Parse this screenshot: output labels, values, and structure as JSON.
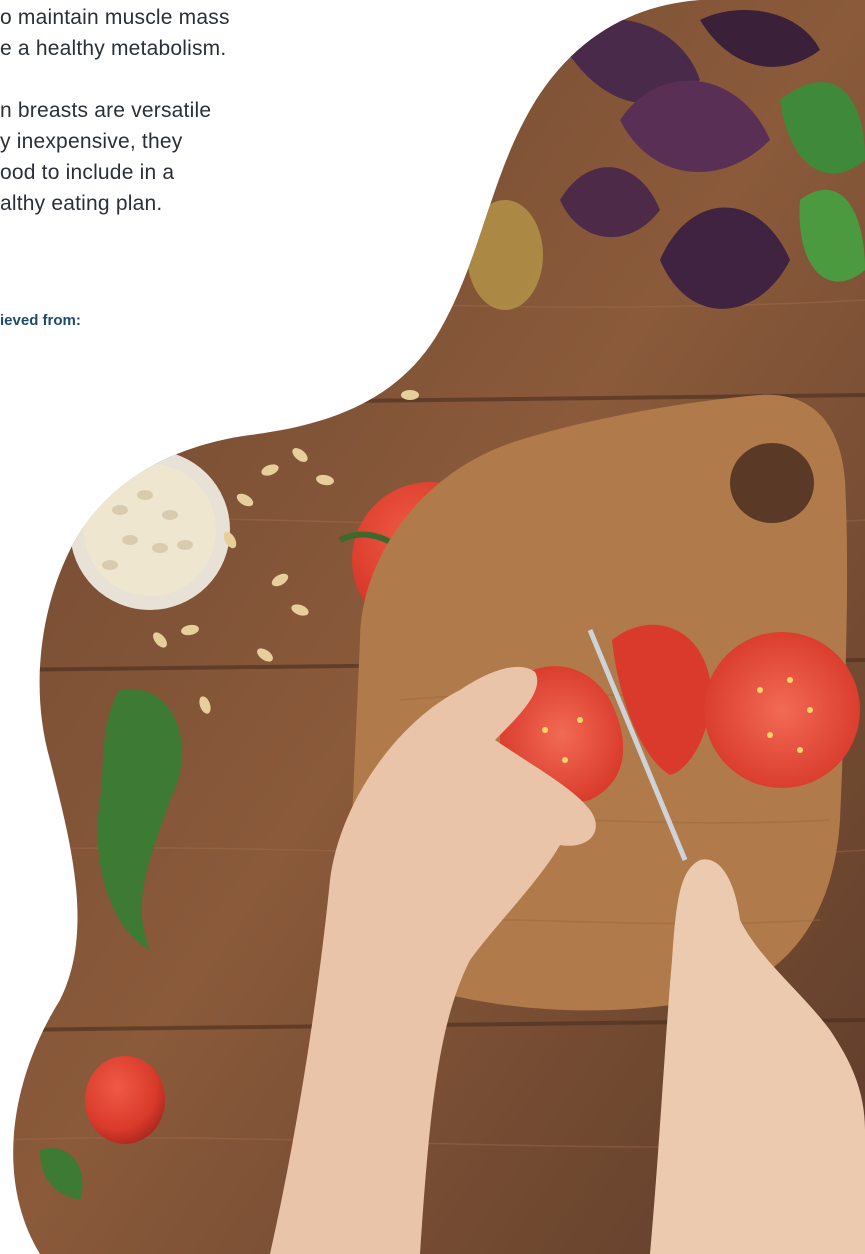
{
  "article": {
    "paragraph_1": [
      "o maintain muscle mass",
      "e a healthy metabolism."
    ],
    "paragraph_2": [
      "n breasts are versatile",
      "y inexpensive, they",
      "ood to include in a",
      "althy eating plan."
    ],
    "retrieved_label": "ieved from:"
  },
  "photo": {
    "subject": "hands slicing tomato on wooden cutting board",
    "colors": {
      "wood": "#8a5a3a",
      "tomato": "#d93a2b",
      "basil_purple": "#4a2a4a",
      "basil_green": "#3f8a3a",
      "skin": "#e9c4a8",
      "link": "#1f4a6b",
      "text": "#2b2f3a"
    }
  }
}
